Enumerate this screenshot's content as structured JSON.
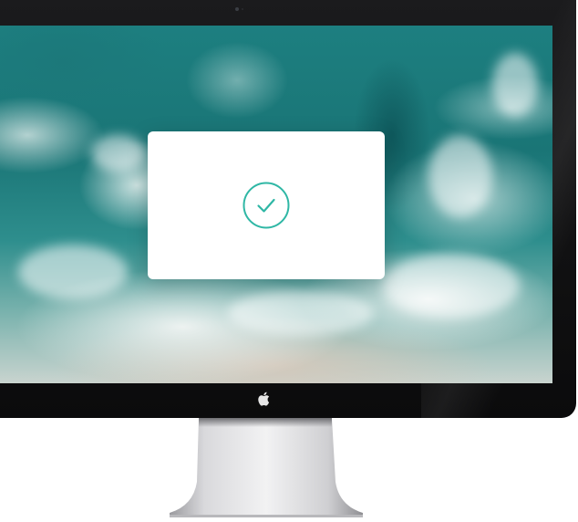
{
  "screen": {
    "wallpaper": "ocean-aerial-waves"
  },
  "modal": {
    "icon": "check-circle-icon",
    "accent_color": "#2fb7a5",
    "background": "#ffffff"
  },
  "monitor": {
    "logo_icon": "apple-logo-icon",
    "bezel_color": "#111112",
    "stand_color": "#c9c9cc"
  }
}
